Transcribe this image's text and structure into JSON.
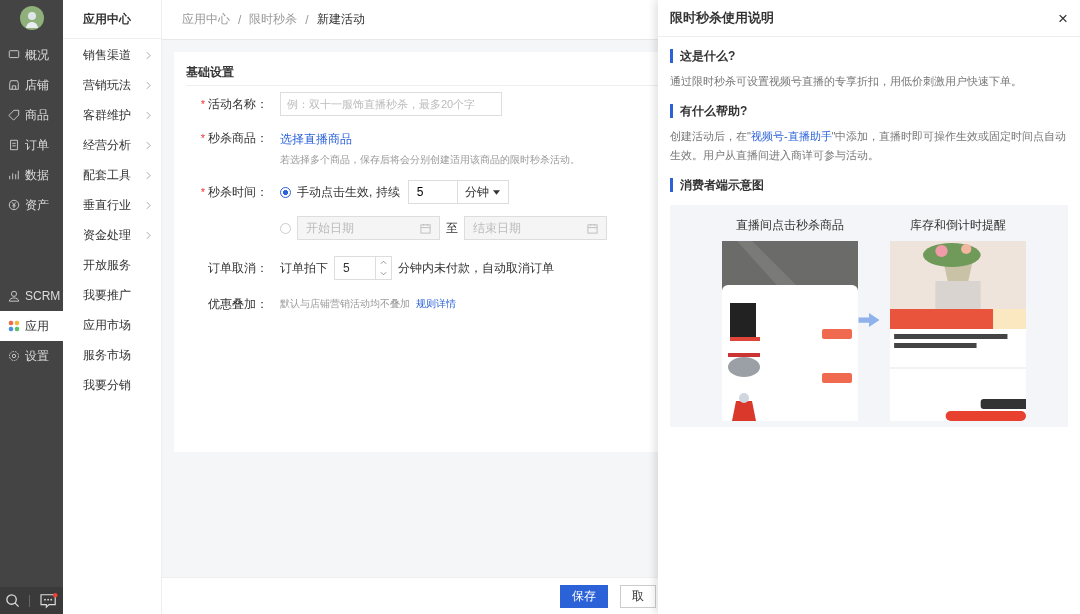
{
  "nav": {
    "items": [
      {
        "label": "概况",
        "selected": false
      },
      {
        "label": "店铺",
        "selected": false
      },
      {
        "label": "商品",
        "selected": false
      },
      {
        "label": "订单",
        "selected": false
      },
      {
        "label": "数据",
        "selected": false
      },
      {
        "label": "资产",
        "selected": false
      },
      {
        "label": "SCRM",
        "selected": false
      },
      {
        "label": "应用",
        "selected": true
      },
      {
        "label": "设置",
        "selected": false
      }
    ],
    "unread": true
  },
  "submenu": {
    "title": "应用中心",
    "items": [
      {
        "label": "销售渠道",
        "expandable": true
      },
      {
        "label": "营销玩法",
        "expandable": true
      },
      {
        "label": "客群维护",
        "expandable": true
      },
      {
        "label": "经营分析",
        "expandable": true
      },
      {
        "label": "配套工具",
        "expandable": true
      },
      {
        "label": "垂直行业",
        "expandable": true
      },
      {
        "label": "资金处理",
        "expandable": true
      },
      {
        "label": "开放服务",
        "expandable": false
      },
      {
        "label": "我要推广",
        "expandable": false
      },
      {
        "label": "应用市场",
        "expandable": false
      },
      {
        "label": "服务市场",
        "expandable": false
      },
      {
        "label": "我要分销",
        "expandable": false
      }
    ]
  },
  "breadcrumb": {
    "separator": "/",
    "items": [
      "应用中心",
      "限时秒杀",
      "新建活动"
    ]
  },
  "form": {
    "title": "基础设置",
    "required_mark": "*",
    "rows": [
      {
        "kind": "text",
        "label": "活动名称：",
        "required": true,
        "placeholder": "例：双十一服饰直播秒杀，最多20个字"
      },
      {
        "kind": "link",
        "label": "秒杀商品：",
        "required": true,
        "link": "选择直播商品",
        "note": "若选择多个商品，保存后将会分别创建适用该商品的限时秒杀活动。"
      },
      {
        "kind": "time",
        "label": "秒杀时间：",
        "required": true,
        "manual": {
          "selected": true,
          "text": "手动点击生效, 持续",
          "value": "5",
          "unit": "分钟"
        },
        "range": {
          "selected": false,
          "start_placeholder": "开始日期",
          "sep": "至",
          "end_placeholder": "结束日期"
        }
      },
      {
        "kind": "stepper",
        "label": "订单取消：",
        "required": false,
        "before": "订单拍下",
        "value": "5",
        "after": "分钟内未付款，自动取消订单"
      },
      {
        "kind": "note",
        "label": "优惠叠加：",
        "required": false,
        "text": "默认与店铺营销活动均不叠加",
        "link": "规则详情"
      }
    ]
  },
  "footer": {
    "buttons": [
      {
        "label": "保存",
        "primary": true
      },
      {
        "label": "取",
        "primary": false
      }
    ]
  },
  "drawer": {
    "title": "限时秒杀使用说明",
    "close": "×",
    "sections": [
      {
        "heading": "这是什么?",
        "text": "通过限时秒杀可设置视频号直播的专享折扣，用低价刺激用户快速下单。"
      },
      {
        "heading": "有什么帮助?",
        "before": "创建活动后，在\"",
        "link": "视频号-直播助手",
        "after": "\"中添加，直播时即可操作生效或固定时间点自动生效。用户从直播间进入商详可参与活动。"
      },
      {
        "heading": "消费者端示意图"
      }
    ],
    "figures": [
      {
        "caption": "直播间点击秒杀商品",
        "kind": "picture"
      },
      {
        "caption": "库存和倒计时提醒",
        "kind": "picture"
      }
    ]
  }
}
